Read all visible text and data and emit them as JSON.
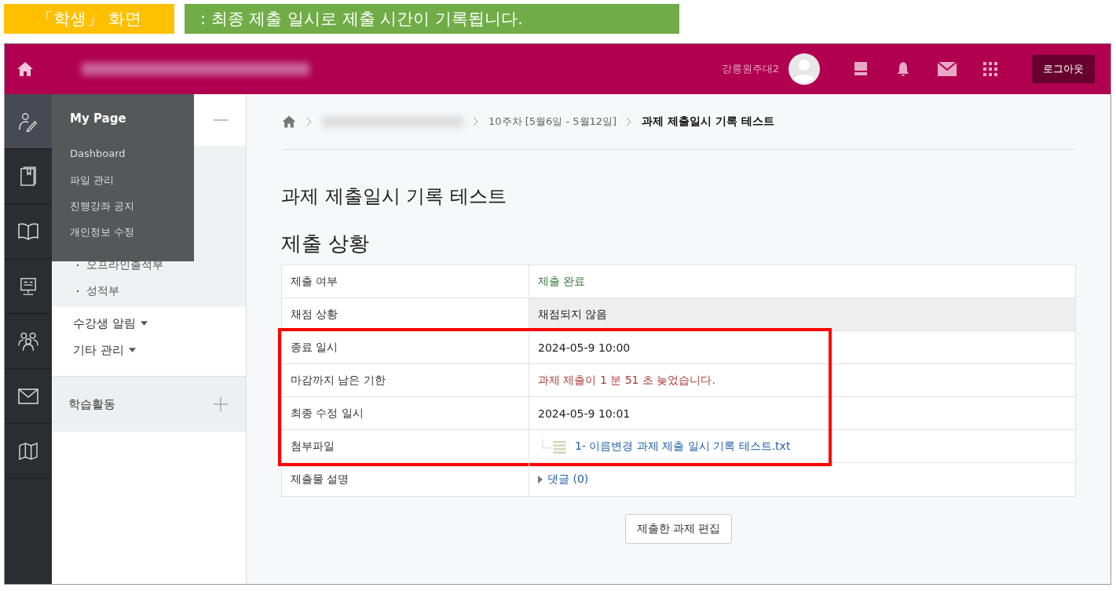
{
  "annotation": {
    "tag": "「학생」 화면",
    "note": ":  최종 제출 일시로 제출 시간이 기록됩니다."
  },
  "header": {
    "user_name": "강릉원주대2",
    "logout": "로그아웃"
  },
  "rail": [
    {
      "kind": "person",
      "selected": true
    },
    {
      "kind": "book",
      "selected": false
    },
    {
      "kind": "open-book",
      "selected": false
    },
    {
      "kind": "board",
      "selected": false
    },
    {
      "kind": "people",
      "selected": false
    },
    {
      "kind": "mail",
      "selected": false
    },
    {
      "kind": "map",
      "selected": false
    }
  ],
  "side_panel": {
    "top_expanded": true,
    "sub_items": [
      "오프라인출석부",
      "성적부"
    ],
    "menus": [
      {
        "label": "수강생 알림",
        "expanded": false
      },
      {
        "label": "기타 관리",
        "expanded": false
      }
    ],
    "activity": {
      "label": "학습활동",
      "expanded": false
    }
  },
  "dropdown": {
    "title": "My Page",
    "items": [
      "Dashboard",
      "파일 관리",
      "진행강좌 공지",
      "개인정보 수정"
    ]
  },
  "breadcrumb": [
    {
      "kind": "redacted"
    },
    {
      "kind": "text",
      "text": "10주차 [5월6일 - 5월12일]"
    }
  ],
  "breadcrumb_current": "과제 제출일시 기록 테스트",
  "title": "과제 제출일시 기록 테스트",
  "section_heading": "제출 상황",
  "table": {
    "row_groups": [
      {
        "highlighted": false,
        "rows": [
          {
            "label": "제출 여부",
            "value": "제출 완료",
            "kind": "success",
            "shaded": false
          },
          {
            "label": "채점 상황",
            "value": "채점되지 않음",
            "kind": "plain",
            "shaded": true
          }
        ]
      },
      {
        "highlighted": true,
        "rows": [
          {
            "label": "종료 일시",
            "value": "2024-05-9 10:00",
            "kind": "plain",
            "shaded": false
          },
          {
            "label": "마감까지 남은 기한",
            "value": "과제 제출이 1 분 51 초 늦었습니다.",
            "kind": "late",
            "shaded": false
          },
          {
            "label": "최종 수정 일시",
            "value": "2024-05-9 10:01",
            "kind": "plain",
            "shaded": false
          },
          {
            "label": "첨부파일",
            "value": "1- 이름변경 과제 제출 일시 기록 테스트.txt",
            "kind": "file",
            "shaded": false
          }
        ]
      },
      {
        "highlighted": false,
        "rows": [
          {
            "label": "제출물 설명",
            "value": "댓글 (0)",
            "kind": "comments",
            "shaded": false
          }
        ]
      }
    ]
  },
  "edit_button": "제출한 과제 편집"
}
